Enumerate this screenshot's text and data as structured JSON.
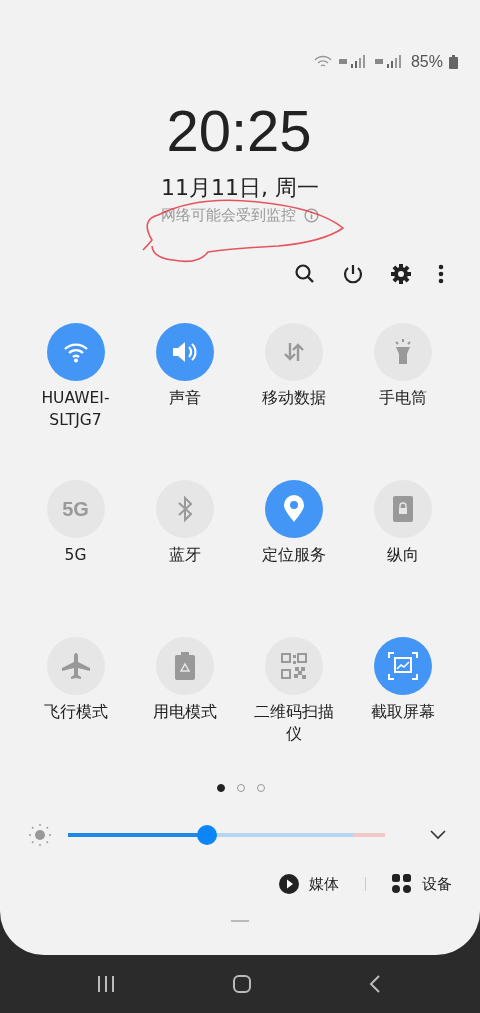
{
  "status_bar": {
    "battery": "85%"
  },
  "clock": {
    "time": "20:25",
    "date": "11月11日, 周一",
    "notice": "网络可能会受到监控"
  },
  "tiles": [
    {
      "label": "HUAWEI-SLTJG7",
      "on": true
    },
    {
      "label": "声音",
      "on": true
    },
    {
      "label": "移动数据",
      "on": false
    },
    {
      "label": "手电筒",
      "on": false
    },
    {
      "label": "5G",
      "on": false,
      "icon_text": "5G"
    },
    {
      "label": "蓝牙",
      "on": false
    },
    {
      "label": "定位服务",
      "on": true
    },
    {
      "label": "纵向",
      "on": false
    },
    {
      "label": "飞行模式",
      "on": false
    },
    {
      "label": "用电模式",
      "on": false
    },
    {
      "label": "二维码扫描仪",
      "on": false
    },
    {
      "label": "截取屏幕",
      "on": true
    }
  ],
  "pages": [
    {
      "selected": true
    },
    {
      "selected": false
    },
    {
      "selected": false
    }
  ],
  "brightness": {
    "level": 0.44
  },
  "output": {
    "media": "媒体",
    "devices": "设备"
  }
}
